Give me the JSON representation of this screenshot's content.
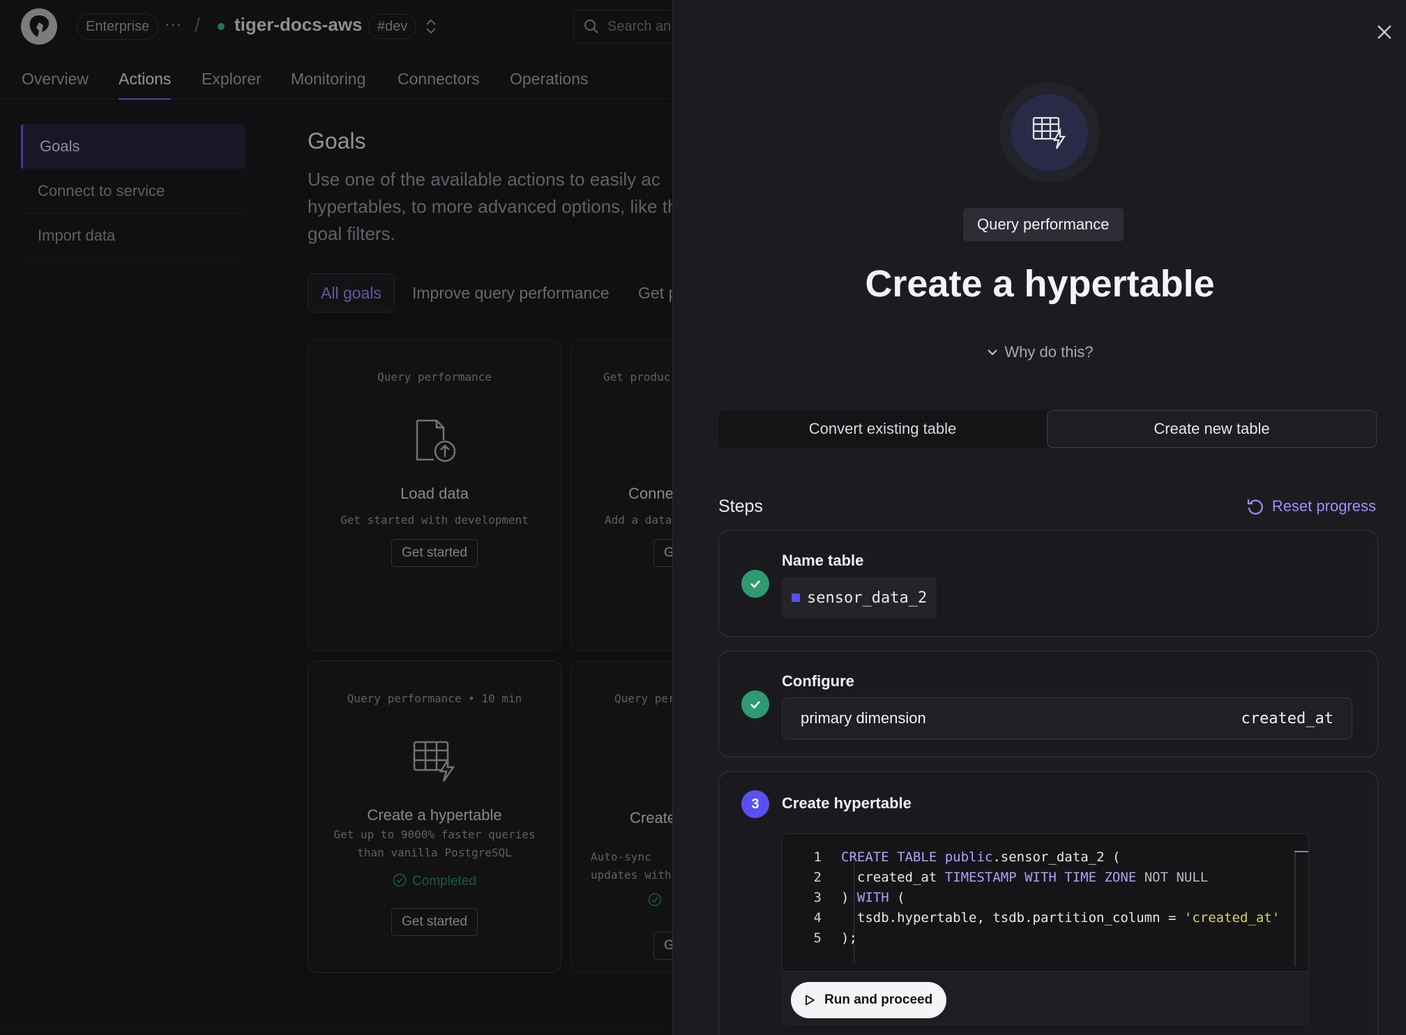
{
  "topbar": {
    "plan": "Enterprise",
    "more": "···",
    "separator": "/",
    "project": "tiger-docs-aws",
    "env": "#dev",
    "search_placeholder": "Search an"
  },
  "nav": {
    "tabs": [
      {
        "label": "Overview"
      },
      {
        "label": "Actions"
      },
      {
        "label": "Explorer"
      },
      {
        "label": "Monitoring"
      },
      {
        "label": "Connectors"
      },
      {
        "label": "Operations"
      }
    ],
    "active": "Actions"
  },
  "sidebar": {
    "items": [
      {
        "label": "Goals"
      },
      {
        "label": "Connect to service"
      },
      {
        "label": "Import data"
      }
    ],
    "active": "Goals"
  },
  "main": {
    "title": "Goals",
    "description": "Use one of the available actions to easily ac hypertables, to more advanced options, like the goal filters.",
    "filters": [
      {
        "label": "All goals"
      },
      {
        "label": "Improve query performance"
      },
      {
        "label": "Get p"
      }
    ],
    "cards": [
      {
        "category": "Query performance",
        "title": "Load data",
        "desc": "Get started with development",
        "status": "",
        "button": "Get started"
      },
      {
        "category": "Get produc",
        "title": "Conne",
        "desc": "Add a data",
        "status": "",
        "button": "G"
      },
      {
        "category": "Query performance • 10 min",
        "title": "Create a hypertable",
        "desc": "Get up to 9000% faster queries than vanilla PostgreSQL",
        "status": "Completed",
        "button": "Get started"
      },
      {
        "category": "Query per",
        "title": "Create ag",
        "desc": "Auto-sync updates with",
        "status": "",
        "button": "G"
      }
    ]
  },
  "drawer": {
    "badge": "Query performance",
    "title": "Create a hypertable",
    "why": "Why do this?",
    "segments": [
      {
        "label": "Convert existing table"
      },
      {
        "label": "Create new table"
      }
    ],
    "steps_label": "Steps",
    "reset_label": "Reset progress",
    "steps": {
      "name_table": {
        "title": "Name table",
        "value": "sensor_data_2"
      },
      "configure": {
        "title": "Configure",
        "label": "primary dimension",
        "value": "created_at"
      },
      "create": {
        "number": "3",
        "title": "Create hypertable",
        "run_label": "Run and proceed"
      }
    },
    "code": {
      "line_numbers": [
        "1",
        "2",
        "3",
        "4",
        "5"
      ],
      "line1": {
        "kw": "CREATE TABLE ",
        "kw2": "public",
        "rest": ".sensor_data_2 ("
      },
      "line2": {
        "indent": "  created_at ",
        "kw": "TIMESTAMP WITH TIME ZONE",
        "rest": " NOT NULL"
      },
      "line3": {
        "pre": ") ",
        "kw": "WITH",
        "rest": " ("
      },
      "line4": {
        "pre": "  tsdb.hypertable, tsdb.partition_column = ",
        "str": "'created_at'"
      },
      "line5": {
        "pre": ");"
      }
    }
  },
  "colors": {
    "accent": "#5a4ff2",
    "link": "#9b90ff",
    "success": "#2d9a72"
  }
}
